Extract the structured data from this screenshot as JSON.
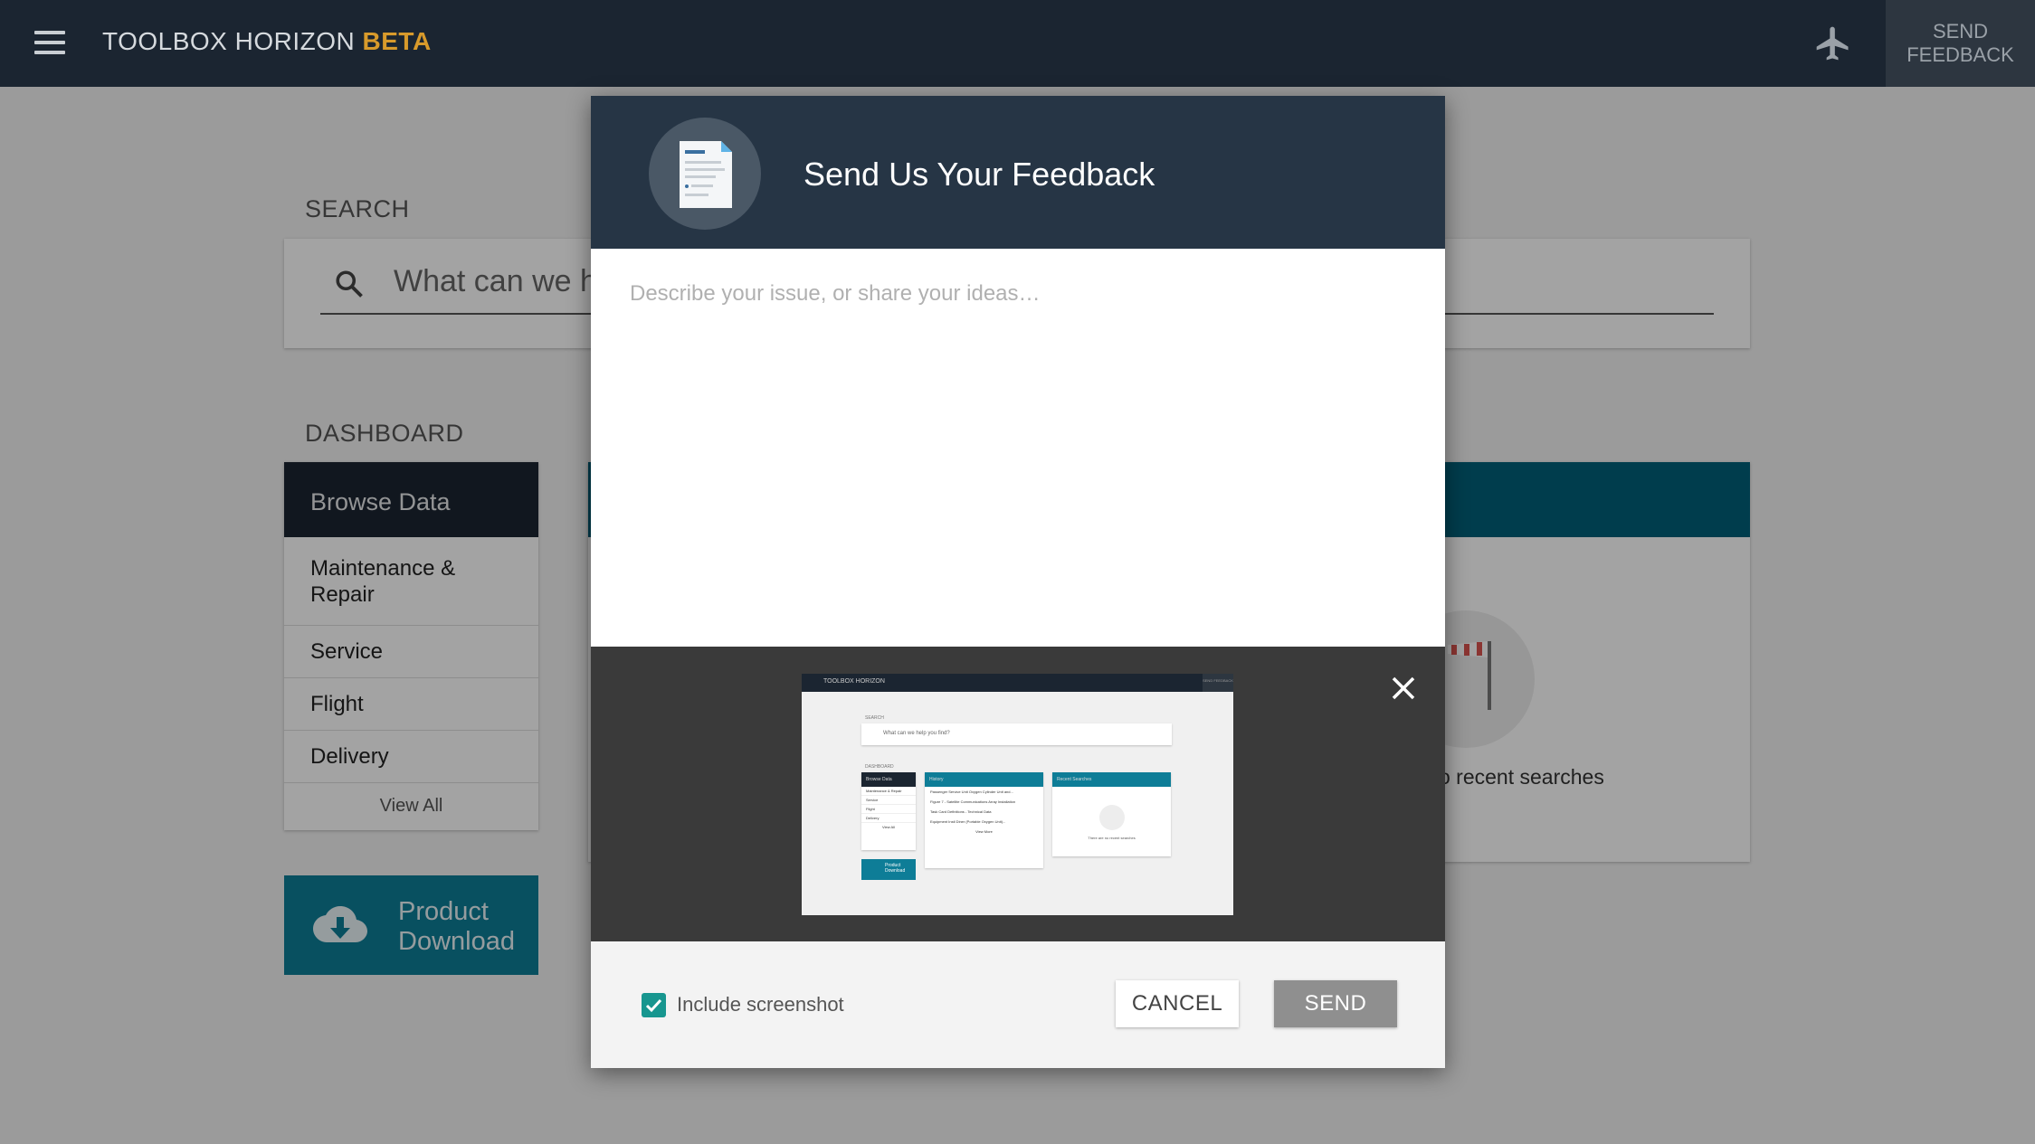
{
  "app": {
    "title_main": "TOOLBOX HORIZON",
    "title_badge": "BETA",
    "send_feedback_label": "SEND FEEDBACK",
    "icons": {
      "menu": "hamburger-menu-icon",
      "aircraft": "airplane-icon"
    }
  },
  "search": {
    "section_label": "SEARCH",
    "placeholder": "What can we help you find?",
    "icon": "search-icon"
  },
  "dashboard": {
    "section_label": "DASHBOARD",
    "browse": {
      "title": "Browse Data",
      "items": [
        "Maintenance & Repair",
        "Service",
        "Flight",
        "Delivery"
      ],
      "view_all": "View All"
    },
    "product_download": {
      "label_line1": "Product",
      "label_line2": "Download",
      "icon": "cloud-download-icon"
    },
    "recent_searches": {
      "empty_text": "o recent searches"
    }
  },
  "modal": {
    "title": "Send Us Your Feedback",
    "placeholder": "Describe your issue, or share your ideas…",
    "include_screenshot_label": "Include screenshot",
    "include_screenshot_checked": true,
    "cancel_label": "CANCEL",
    "send_label": "SEND",
    "icons": {
      "header": "document-icon",
      "close": "close-icon",
      "checkbox": "checkmark-icon"
    }
  },
  "thumbnail": {
    "title": "TOOLBOX HORIZON",
    "feedback": "SEND FEEDBACK",
    "search_label": "SEARCH",
    "search_placeholder": "What can we help you find?",
    "dashboard_label": "DASHBOARD",
    "browse_title": "Browse Data",
    "browse_items": [
      "Maintenance & Repair",
      "Service",
      "Flight",
      "Delivery",
      "View All"
    ],
    "product": "Product Download",
    "history_title": "History",
    "history_items": [
      "Passenger Service Unit Oxygen Cylinder Unit and...",
      "Figure 7 - Satellite Communications Array Installation",
      "Task Card Definitions - Technical Data",
      "Equipment Instl Diner (Portable Oxygen Unit)..."
    ],
    "history_view": "View More",
    "recent_title": "Recent Searches",
    "recent_empty": "There are no recent searches"
  },
  "colors": {
    "topbar": "#1b2531",
    "accent_teal": "#0e7d97",
    "beta_gold": "#d89a2b",
    "modal_header": "#263545",
    "checkbox": "#17968f"
  }
}
